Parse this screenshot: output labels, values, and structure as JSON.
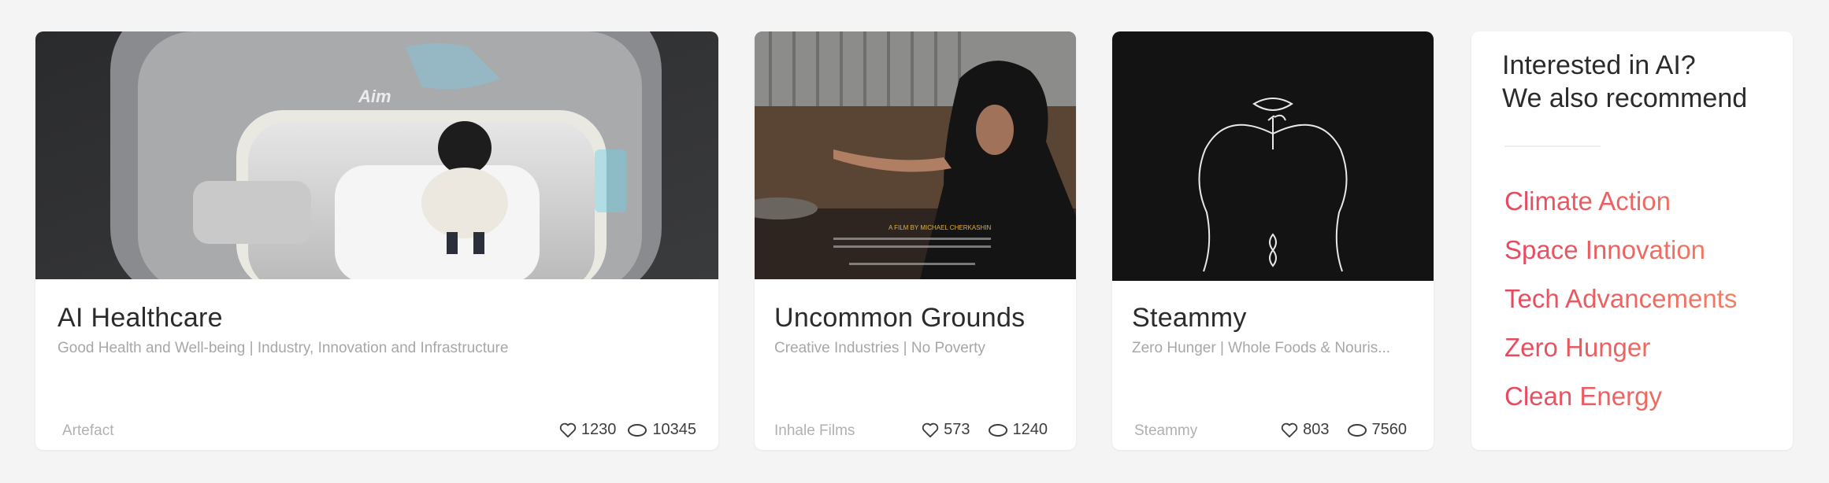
{
  "cards": [
    {
      "title": "AI Healthcare",
      "subtitle": "Good Health and Well-being | Industry, Innovation and Infrastructure",
      "author": "Artefact",
      "likes": "1230",
      "comments": "10345",
      "image_text": "Aim"
    },
    {
      "title": "Uncommon Grounds",
      "subtitle": "Creative Industries | No Poverty",
      "author": "Inhale Films",
      "likes": "573",
      "comments": "1240",
      "image_text": "A FILM BY MICHAEL CHERKASHIN"
    },
    {
      "title": "Steammy",
      "subtitle": "Zero Hunger | Whole Foods & Nouris...",
      "author": "Steammy",
      "likes": "803",
      "comments": "7560"
    }
  ],
  "recommend": {
    "heading_line1": "Interested in AI?",
    "heading_line2": "We also recommend",
    "items": [
      "Climate Action",
      "Space Innovation",
      "Tech Advancements",
      "Zero Hunger",
      "Clean Energy"
    ]
  },
  "colors": {
    "accent_start": "#e8475f",
    "accent_end": "#f08064",
    "background": "#f4f4f4"
  },
  "icons": [
    "heart-icon",
    "comment-icon"
  ]
}
